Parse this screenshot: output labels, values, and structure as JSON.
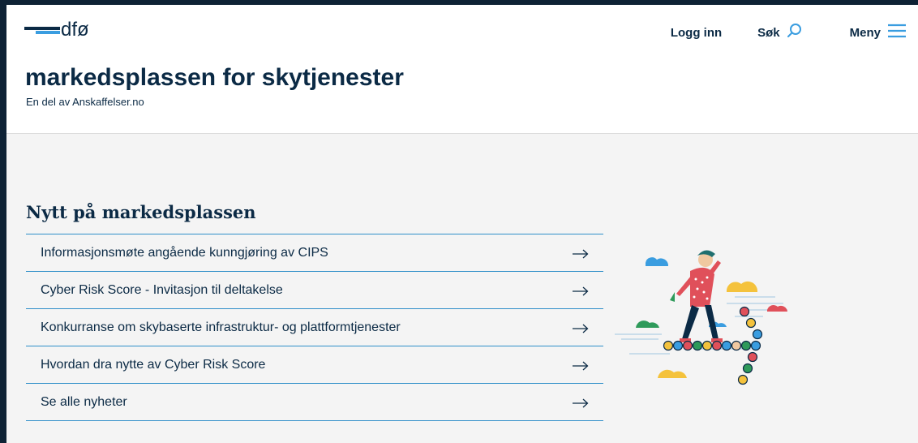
{
  "header": {
    "logo_text": "dfø",
    "nav": {
      "login_label": "Logg inn",
      "search_label": "Søk",
      "menu_label": "Meny"
    },
    "site_title": "markedsplassen for skytjenester",
    "subtitle": "En del av Anskaffelser.no"
  },
  "news": {
    "heading": "Nytt på markedsplassen",
    "items": [
      {
        "label": "Informasjonsmøte angående kunngjøring av CIPS"
      },
      {
        "label": "Cyber Risk Score - Invitasjon til deltakelse"
      },
      {
        "label": "Konkurranse om skybaserte infrastruktur- og plattformtjenester"
      },
      {
        "label": "Hvordan dra nytte av Cyber Risk Score"
      },
      {
        "label": "Se alle nyheter"
      }
    ]
  },
  "colors": {
    "brand_dark": "#0b2a45",
    "accent_blue": "#3a9de0",
    "divider_blue": "#2f8fc9",
    "background": "#f4f4f4"
  },
  "icons": [
    "search-icon",
    "menu-icon",
    "arrow-right-icon"
  ]
}
